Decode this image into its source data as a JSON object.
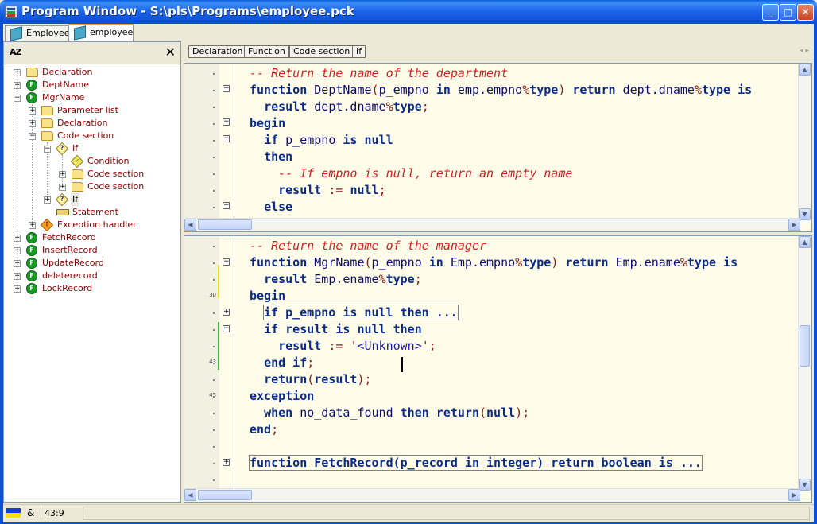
{
  "window": {
    "title": "Program Window - S:\\pls\\Programs\\employee.pck"
  },
  "tabs": [
    {
      "label": "Employee"
    },
    {
      "label": "employee"
    }
  ],
  "tree": {
    "sort_icon": "AZ",
    "nodes": [
      {
        "label": "Declaration"
      },
      {
        "label": "DeptName"
      },
      {
        "label": "MgrName"
      },
      {
        "label": "Parameter list"
      },
      {
        "label": "Declaration"
      },
      {
        "label": "Code section"
      },
      {
        "label": "If"
      },
      {
        "label": "Condition"
      },
      {
        "label": "Code section"
      },
      {
        "label": "Code section"
      },
      {
        "label": "If"
      },
      {
        "label": "Statement"
      },
      {
        "label": "Exception handler"
      },
      {
        "label": "FetchRecord"
      },
      {
        "label": "InsertRecord"
      },
      {
        "label": "UpdateRecord"
      },
      {
        "label": "deleterecord"
      },
      {
        "label": "LockRecord"
      }
    ]
  },
  "toolbar": {
    "buttons": [
      "Declaration",
      "Function",
      "Code section",
      "If"
    ]
  },
  "editor_top": {
    "lines": [
      {
        "t": [
          [
            "cm",
            "-- Return the name of the department"
          ]
        ]
      },
      {
        "t": [
          [
            "kw",
            "function"
          ],
          [
            "tx",
            " DeptName"
          ],
          [
            "op",
            "("
          ],
          [
            "tx",
            "p_empno "
          ],
          [
            "kw",
            "in"
          ],
          [
            "tx",
            " emp.empno"
          ],
          [
            "op",
            "%"
          ],
          [
            "kw",
            "type"
          ],
          [
            "op",
            ")"
          ],
          [
            "tx",
            " "
          ],
          [
            "kw",
            "return"
          ],
          [
            "tx",
            " dept.dname"
          ],
          [
            "op",
            "%"
          ],
          [
            "kw",
            "type"
          ],
          [
            "tx",
            " "
          ],
          [
            "kw",
            "is"
          ]
        ]
      },
      {
        "t": [
          [
            "tx",
            "  "
          ],
          [
            "kw",
            "result"
          ],
          [
            "tx",
            " dept.dname"
          ],
          [
            "op",
            "%"
          ],
          [
            "kw",
            "type"
          ],
          [
            "op",
            ";"
          ]
        ]
      },
      {
        "t": [
          [
            "kw",
            "begin"
          ]
        ]
      },
      {
        "t": [
          [
            "tx",
            "  "
          ],
          [
            "kw",
            "if"
          ],
          [
            "tx",
            " p_empno "
          ],
          [
            "kw",
            "is null"
          ]
        ]
      },
      {
        "t": [
          [
            "tx",
            "  "
          ],
          [
            "kw",
            "then"
          ]
        ]
      },
      {
        "t": [
          [
            "tx",
            "    "
          ],
          [
            "cm",
            "-- If empno is null, return an empty name"
          ]
        ]
      },
      {
        "t": [
          [
            "tx",
            "    "
          ],
          [
            "kw",
            "result"
          ],
          [
            "tx",
            " "
          ],
          [
            "op",
            ":="
          ],
          [
            "tx",
            " "
          ],
          [
            "kw",
            "null"
          ],
          [
            "op",
            ";"
          ]
        ]
      },
      {
        "t": [
          [
            "tx",
            "  "
          ],
          [
            "kw",
            "else"
          ]
        ]
      }
    ]
  },
  "editor_bottom": {
    "line_numbers": [
      "30",
      "43",
      "45"
    ],
    "lines": [
      {
        "t": [
          [
            "cm",
            "-- Return the name of the manager"
          ]
        ]
      },
      {
        "t": [
          [
            "kw",
            "function"
          ],
          [
            "tx",
            " MgrName"
          ],
          [
            "op",
            "("
          ],
          [
            "tx",
            "p_empno "
          ],
          [
            "kw",
            "in"
          ],
          [
            "tx",
            " Emp.empno"
          ],
          [
            "op",
            "%"
          ],
          [
            "kw",
            "type"
          ],
          [
            "op",
            ")"
          ],
          [
            "tx",
            " "
          ],
          [
            "kw",
            "return"
          ],
          [
            "tx",
            " Emp.ename"
          ],
          [
            "op",
            "%"
          ],
          [
            "kw",
            "type"
          ],
          [
            "tx",
            " "
          ],
          [
            "kw",
            "is"
          ]
        ]
      },
      {
        "t": [
          [
            "tx",
            "  "
          ],
          [
            "kw",
            "result"
          ],
          [
            "tx",
            " Emp.ename"
          ],
          [
            "op",
            "%"
          ],
          [
            "kw",
            "type"
          ],
          [
            "op",
            ";"
          ]
        ]
      },
      {
        "t": [
          [
            "kw",
            "begin"
          ]
        ]
      },
      {
        "t": [
          [
            "kw",
            "if p_empno is null then ..."
          ]
        ],
        "boxed": true
      },
      {
        "t": [
          [
            "tx",
            "  "
          ],
          [
            "kw",
            "if"
          ],
          [
            "tx",
            " "
          ],
          [
            "kw",
            "result"
          ],
          [
            "tx",
            " "
          ],
          [
            "kw",
            "is null"
          ],
          [
            "tx",
            " "
          ],
          [
            "kw",
            "then"
          ]
        ]
      },
      {
        "t": [
          [
            "tx",
            "    "
          ],
          [
            "kw",
            "result"
          ],
          [
            "tx",
            " "
          ],
          [
            "op",
            ":="
          ],
          [
            "tx",
            " "
          ],
          [
            "op",
            "'"
          ],
          [
            "str",
            "<Unknown>"
          ],
          [
            "op",
            "';"
          ]
        ]
      },
      {
        "t": [
          [
            "tx",
            "  "
          ],
          [
            "kw",
            "end if"
          ],
          [
            "op",
            ";"
          ]
        ]
      },
      {
        "t": [
          [
            "tx",
            "  "
          ],
          [
            "kw",
            "return"
          ],
          [
            "op",
            "("
          ],
          [
            "kw",
            "result"
          ],
          [
            "op",
            ");"
          ]
        ]
      },
      {
        "t": [
          [
            "kw",
            "exception"
          ]
        ]
      },
      {
        "t": [
          [
            "tx",
            "  "
          ],
          [
            "kw",
            "when"
          ],
          [
            "tx",
            " no_data_found "
          ],
          [
            "kw",
            "then"
          ],
          [
            "tx",
            " "
          ],
          [
            "kw",
            "return"
          ],
          [
            "op",
            "("
          ],
          [
            "kw",
            "null"
          ],
          [
            "op",
            ");"
          ]
        ]
      },
      {
        "t": [
          [
            "kw",
            "end"
          ],
          [
            "op",
            ";"
          ]
        ]
      },
      {
        "t": []
      },
      {
        "t": [
          [
            "kw",
            "function FetchRecord(p_record in integer) return boolean is ..."
          ]
        ],
        "boxed": true
      }
    ]
  },
  "status": {
    "symbol": "&",
    "position": "43:9"
  },
  "colors": {
    "titlebar": "#0b4fd6",
    "editor_bg": "#fffde9",
    "keyword": "#0a2a8a",
    "comment": "#d42020"
  }
}
